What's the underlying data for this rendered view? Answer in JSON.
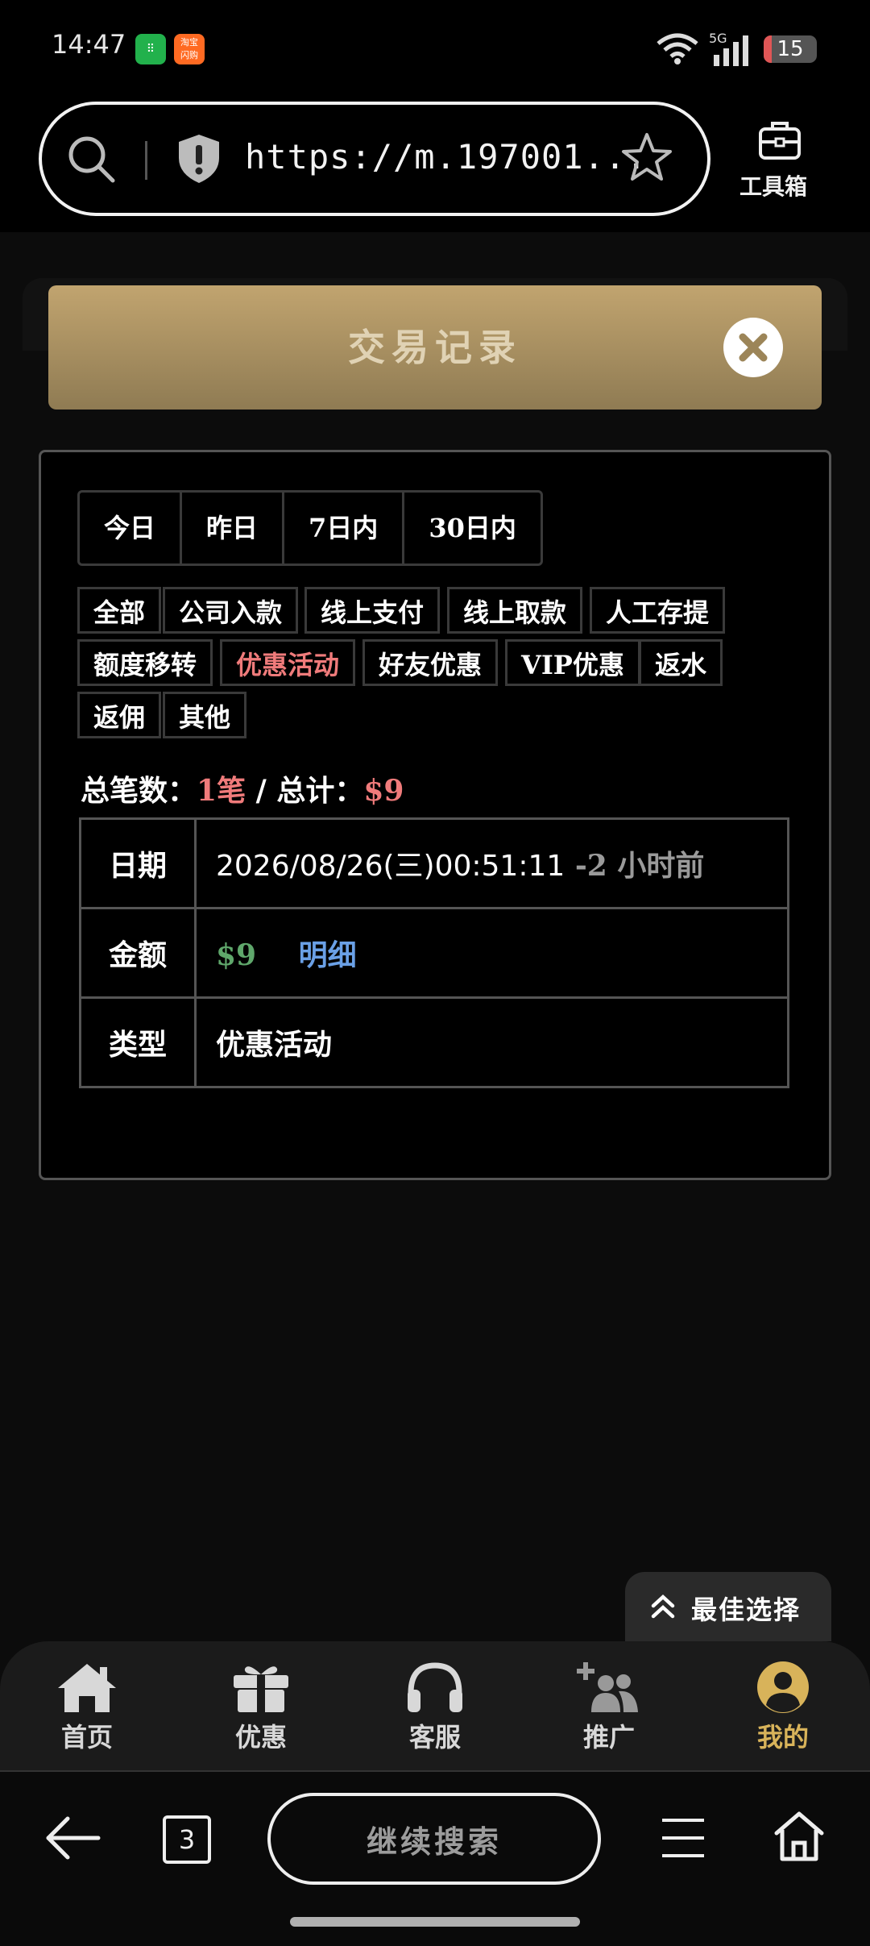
{
  "status": {
    "time": "14:47",
    "battery": "15",
    "battery_level": 0.15,
    "network": "5G"
  },
  "browser": {
    "url": "https://m.197001...",
    "toolbox_label": "工具箱",
    "continue_label": "继续搜索",
    "tab_count": "3"
  },
  "modal": {
    "title": "交易记录"
  },
  "date_filters": [
    "今日",
    "昨日",
    "7日内",
    "30日内"
  ],
  "type_filters": [
    "全部",
    "公司入款",
    "线上支付",
    "线上取款",
    "人工存提",
    "额度移转",
    "优惠活动",
    "好友优惠",
    "VIP优惠",
    "返水",
    "返佣",
    "其他"
  ],
  "summary": {
    "count_label": "总笔数：",
    "count_value": "1笔",
    "separator": "/",
    "total_label": "总计：",
    "total_value": "$9"
  },
  "record": {
    "date_key": "日期",
    "date_value": "2026/08/26(三)00:51:11",
    "date_ago": "-2 小时前",
    "amount_key": "金额",
    "amount_value": "$9",
    "detail_link": "明细",
    "type_key": "类型",
    "type_value": "优惠活动"
  },
  "best_choice": "最佳选择",
  "nav": [
    "首页",
    "优惠",
    "客服",
    "推广",
    "我的"
  ],
  "colors": {
    "accent_gold": "#d8b35a",
    "active_red": "#f07b7b",
    "amount_green": "#5fa76b",
    "link_blue": "#6aa0e6"
  }
}
